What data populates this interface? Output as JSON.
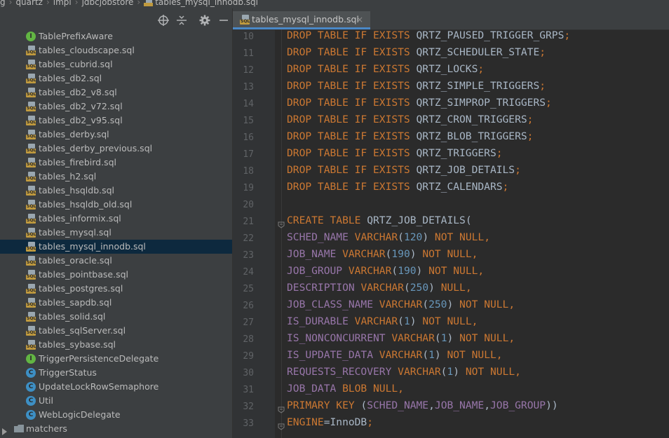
{
  "breadcrumbs": [
    "g",
    "quartz",
    "impl",
    "jdbcjobstore",
    "tables_mysql_innodb.sql"
  ],
  "project": {
    "toolbar_icons": [
      "locate-icon",
      "collapse-icon",
      "gear-icon",
      "minimize-icon"
    ],
    "items": [
      {
        "label": "TablePrefixAware",
        "icon": "interface-icon",
        "type": "interface"
      },
      {
        "label": "tables_cloudscape.sql",
        "icon": "sql-file-icon",
        "type": "sql"
      },
      {
        "label": "tables_cubrid.sql",
        "icon": "sql-file-icon",
        "type": "sql"
      },
      {
        "label": "tables_db2.sql",
        "icon": "sql-file-icon",
        "type": "sql"
      },
      {
        "label": "tables_db2_v8.sql",
        "icon": "sql-file-icon",
        "type": "sql"
      },
      {
        "label": "tables_db2_v72.sql",
        "icon": "sql-file-icon",
        "type": "sql"
      },
      {
        "label": "tables_db2_v95.sql",
        "icon": "sql-file-icon",
        "type": "sql"
      },
      {
        "label": "tables_derby.sql",
        "icon": "sql-file-icon",
        "type": "sql"
      },
      {
        "label": "tables_derby_previous.sql",
        "icon": "sql-file-icon",
        "type": "sql"
      },
      {
        "label": "tables_firebird.sql",
        "icon": "sql-file-icon",
        "type": "sql"
      },
      {
        "label": "tables_h2.sql",
        "icon": "sql-file-icon",
        "type": "sql"
      },
      {
        "label": "tables_hsqldb.sql",
        "icon": "sql-file-icon",
        "type": "sql"
      },
      {
        "label": "tables_hsqldb_old.sql",
        "icon": "sql-file-icon",
        "type": "sql"
      },
      {
        "label": "tables_informix.sql",
        "icon": "sql-file-icon",
        "type": "sql"
      },
      {
        "label": "tables_mysql.sql",
        "icon": "sql-file-icon",
        "type": "sql"
      },
      {
        "label": "tables_mysql_innodb.sql",
        "icon": "sql-file-icon",
        "type": "sql",
        "selected": true
      },
      {
        "label": "tables_oracle.sql",
        "icon": "sql-file-icon",
        "type": "sql"
      },
      {
        "label": "tables_pointbase.sql",
        "icon": "sql-file-icon",
        "type": "sql"
      },
      {
        "label": "tables_postgres.sql",
        "icon": "sql-file-icon",
        "type": "sql"
      },
      {
        "label": "tables_sapdb.sql",
        "icon": "sql-file-icon",
        "type": "sql"
      },
      {
        "label": "tables_solid.sql",
        "icon": "sql-file-icon",
        "type": "sql"
      },
      {
        "label": "tables_sqlServer.sql",
        "icon": "sql-file-icon",
        "type": "sql"
      },
      {
        "label": "tables_sybase.sql",
        "icon": "sql-file-icon",
        "type": "sql"
      },
      {
        "label": "TriggerPersistenceDelegate",
        "icon": "interface-icon",
        "type": "interface"
      },
      {
        "label": "TriggerStatus",
        "icon": "class-icon",
        "type": "class"
      },
      {
        "label": "UpdateLockRowSemaphore",
        "icon": "class-icon",
        "type": "class"
      },
      {
        "label": "Util",
        "icon": "class-icon",
        "type": "class"
      },
      {
        "label": "WebLogicDelegate",
        "icon": "class-icon",
        "type": "class"
      },
      {
        "label": "matchers",
        "icon": "folder-icon",
        "type": "folder"
      }
    ]
  },
  "editor": {
    "tab": {
      "label": "tables_mysql_innodb.sql",
      "close": "×"
    },
    "lines": [
      {
        "n": "10",
        "t": [
          [
            "k",
            "DROP TABLE IF EXISTS "
          ],
          [
            "n",
            "QRTZ_PAUSED_TRIGGER_GRPS"
          ],
          [
            "k",
            ";"
          ]
        ]
      },
      {
        "n": "11",
        "t": [
          [
            "k",
            "DROP TABLE IF EXISTS "
          ],
          [
            "n",
            "QRTZ_SCHEDULER_STATE"
          ],
          [
            "k",
            ";"
          ]
        ]
      },
      {
        "n": "12",
        "t": [
          [
            "k",
            "DROP TABLE IF EXISTS "
          ],
          [
            "n",
            "QRTZ_LOCKS"
          ],
          [
            "k",
            ";"
          ]
        ]
      },
      {
        "n": "13",
        "t": [
          [
            "k",
            "DROP TABLE IF EXISTS "
          ],
          [
            "n",
            "QRTZ_SIMPLE_TRIGGERS"
          ],
          [
            "k",
            ";"
          ]
        ]
      },
      {
        "n": "14",
        "t": [
          [
            "k",
            "DROP TABLE IF EXISTS "
          ],
          [
            "n",
            "QRTZ_SIMPROP_TRIGGERS"
          ],
          [
            "k",
            ";"
          ]
        ]
      },
      {
        "n": "15",
        "t": [
          [
            "k",
            "DROP TABLE IF EXISTS "
          ],
          [
            "n",
            "QRTZ_CRON_TRIGGERS"
          ],
          [
            "k",
            ";"
          ]
        ]
      },
      {
        "n": "16",
        "t": [
          [
            "k",
            "DROP TABLE IF EXISTS "
          ],
          [
            "n",
            "QRTZ_BLOB_TRIGGERS"
          ],
          [
            "k",
            ";"
          ]
        ]
      },
      {
        "n": "17",
        "t": [
          [
            "k",
            "DROP TABLE IF EXISTS "
          ],
          [
            "n",
            "QRTZ_TRIGGERS"
          ],
          [
            "k",
            ";"
          ]
        ]
      },
      {
        "n": "18",
        "t": [
          [
            "k",
            "DROP TABLE IF EXISTS "
          ],
          [
            "n",
            "QRTZ_JOB_DETAILS"
          ],
          [
            "k",
            ";"
          ]
        ]
      },
      {
        "n": "19",
        "t": [
          [
            "k",
            "DROP TABLE IF EXISTS "
          ],
          [
            "n",
            "QRTZ_CALENDARS"
          ],
          [
            "k",
            ";"
          ]
        ]
      },
      {
        "n": "20",
        "t": []
      },
      {
        "n": "21",
        "fold": true,
        "t": [
          [
            "k",
            "CREATE TABLE "
          ],
          [
            "n",
            "QRTZ_JOB_DETAILS("
          ]
        ]
      },
      {
        "n": "22",
        "t": [
          [
            "f",
            "SCHED_NAME "
          ],
          [
            "k",
            "VARCHAR"
          ],
          [
            "p",
            "("
          ],
          [
            "num",
            "120"
          ],
          [
            "p",
            ") "
          ],
          [
            "k",
            "NOT NULL,"
          ]
        ]
      },
      {
        "n": "23",
        "t": [
          [
            "f",
            "JOB_NAME "
          ],
          [
            "k",
            "VARCHAR"
          ],
          [
            "p",
            "("
          ],
          [
            "num",
            "190"
          ],
          [
            "p",
            ") "
          ],
          [
            "k",
            "NOT NULL,"
          ]
        ]
      },
      {
        "n": "24",
        "t": [
          [
            "f",
            "JOB_GROUP "
          ],
          [
            "k",
            "VARCHAR"
          ],
          [
            "p",
            "("
          ],
          [
            "num",
            "190"
          ],
          [
            "p",
            ") "
          ],
          [
            "k",
            "NOT NULL,"
          ]
        ]
      },
      {
        "n": "25",
        "t": [
          [
            "f",
            "DESCRIPTION "
          ],
          [
            "k",
            "VARCHAR"
          ],
          [
            "p",
            "("
          ],
          [
            "num",
            "250"
          ],
          [
            "p",
            ") "
          ],
          [
            "k",
            "NULL,"
          ]
        ]
      },
      {
        "n": "26",
        "t": [
          [
            "f",
            "JOB_CLASS_NAME "
          ],
          [
            "k",
            "VARCHAR"
          ],
          [
            "p",
            "("
          ],
          [
            "num",
            "250"
          ],
          [
            "p",
            ") "
          ],
          [
            "k",
            "NOT NULL,"
          ]
        ]
      },
      {
        "n": "27",
        "t": [
          [
            "f",
            "IS_DURABLE "
          ],
          [
            "k",
            "VARCHAR"
          ],
          [
            "p",
            "("
          ],
          [
            "num",
            "1"
          ],
          [
            "p",
            ") "
          ],
          [
            "k",
            "NOT NULL,"
          ]
        ]
      },
      {
        "n": "28",
        "t": [
          [
            "f",
            "IS_NONCONCURRENT "
          ],
          [
            "k",
            "VARCHAR"
          ],
          [
            "p",
            "("
          ],
          [
            "num",
            "1"
          ],
          [
            "p",
            ") "
          ],
          [
            "k",
            "NOT NULL,"
          ]
        ]
      },
      {
        "n": "29",
        "t": [
          [
            "f",
            "IS_UPDATE_DATA "
          ],
          [
            "k",
            "VARCHAR"
          ],
          [
            "p",
            "("
          ],
          [
            "num",
            "1"
          ],
          [
            "p",
            ") "
          ],
          [
            "k",
            "NOT NULL,"
          ]
        ]
      },
      {
        "n": "30",
        "t": [
          [
            "f",
            "REQUESTS_RECOVERY "
          ],
          [
            "k",
            "VARCHAR"
          ],
          [
            "p",
            "("
          ],
          [
            "num",
            "1"
          ],
          [
            "p",
            ") "
          ],
          [
            "k",
            "NOT NULL,"
          ]
        ]
      },
      {
        "n": "31",
        "t": [
          [
            "f",
            "JOB_DATA "
          ],
          [
            "k",
            "BLOB NULL,"
          ]
        ]
      },
      {
        "n": "32",
        "fold": true,
        "t": [
          [
            "k",
            "PRIMARY KEY "
          ],
          [
            "p",
            "("
          ],
          [
            "f",
            "SCHED_NAME"
          ],
          [
            "p",
            ","
          ],
          [
            "f",
            "JOB_NAME"
          ],
          [
            "p",
            ","
          ],
          [
            "f",
            "JOB_GROUP"
          ],
          [
            "p",
            "))"
          ]
        ]
      },
      {
        "n": "33",
        "fold": true,
        "t": [
          [
            "k",
            "ENGINE"
          ],
          [
            "p",
            "=InnoDB"
          ],
          [
            "k",
            ";"
          ]
        ]
      }
    ]
  }
}
